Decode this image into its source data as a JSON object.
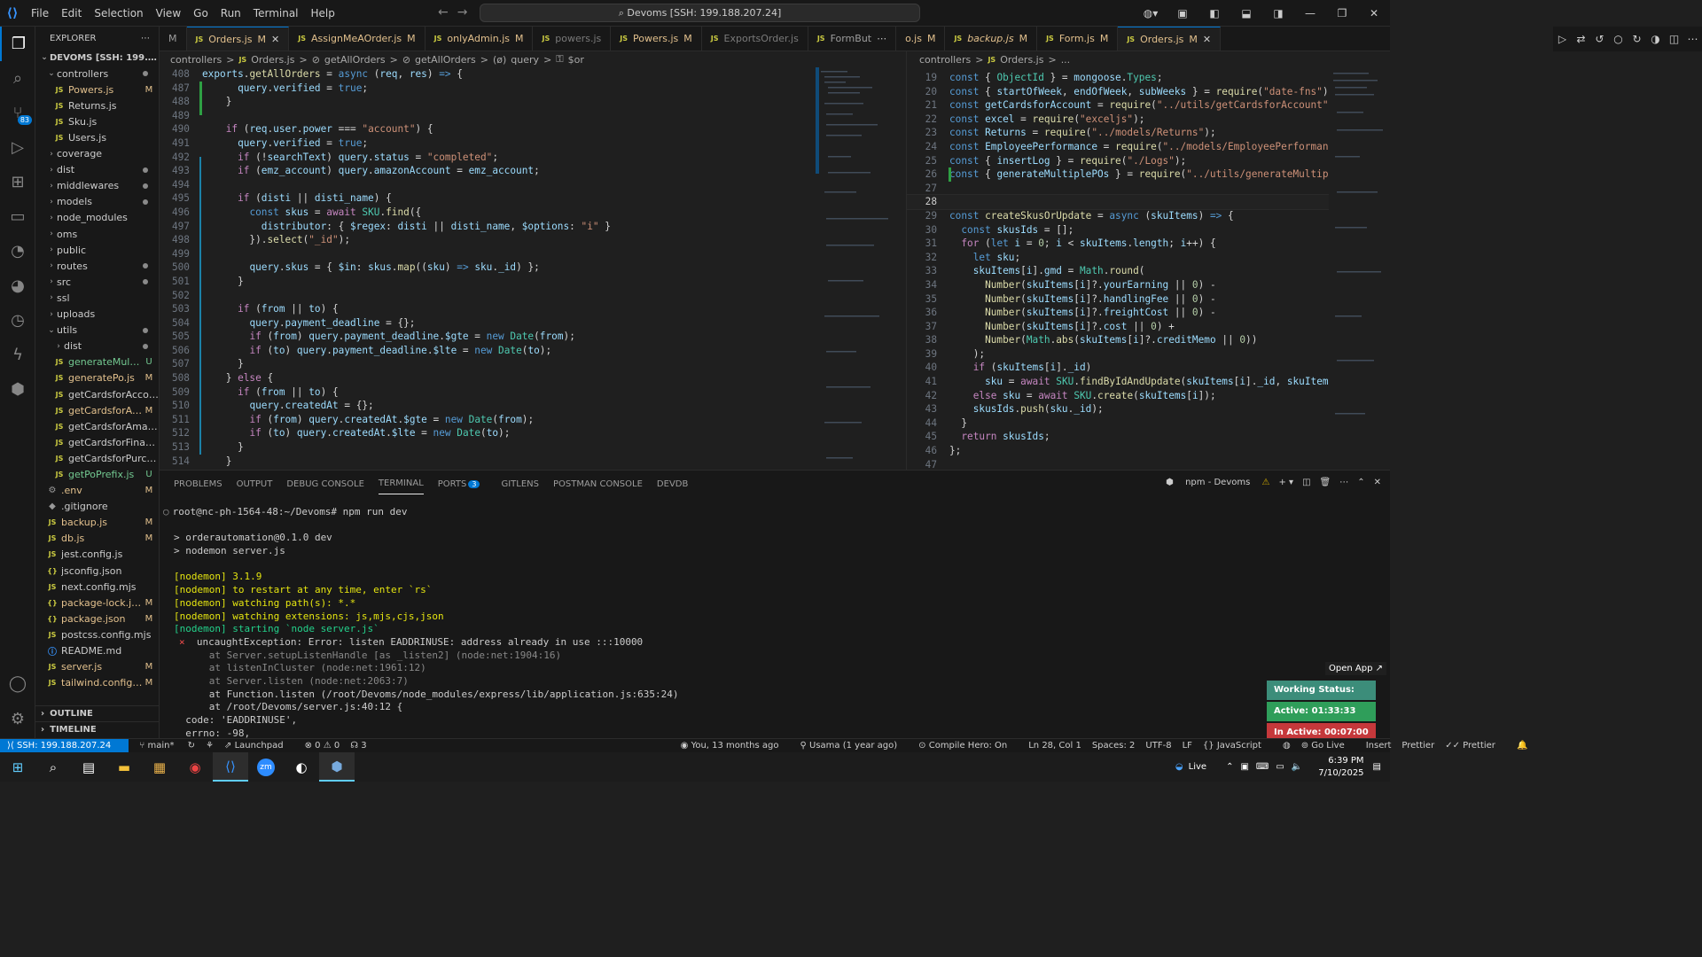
{
  "menu": [
    "File",
    "Edit",
    "Selection",
    "View",
    "Go",
    "Run",
    "Terminal",
    "Help"
  ],
  "title": "Devoms [SSH: 199.188.207.24]",
  "explorer": {
    "title": "EXPLORER",
    "root": "DEVOMS [SSH: 199.188.20...",
    "outline": "OUTLINE",
    "timeline": "TIMELINE"
  },
  "tree": [
    {
      "l": "controllers",
      "t": "folder",
      "o": true,
      "d": 1,
      "s": "dot"
    },
    {
      "l": "Powers.js",
      "t": "js",
      "d": 2,
      "s": "M"
    },
    {
      "l": "Returns.js",
      "t": "js",
      "d": 2,
      "s": ""
    },
    {
      "l": "Sku.js",
      "t": "js",
      "d": 2,
      "s": ""
    },
    {
      "l": "Users.js",
      "t": "js",
      "d": 2,
      "s": ""
    },
    {
      "l": "coverage",
      "t": "folder",
      "d": 1,
      "s": ""
    },
    {
      "l": "dist",
      "t": "folder",
      "d": 1,
      "s": "dot"
    },
    {
      "l": "middlewares",
      "t": "folder",
      "d": 1,
      "s": "dot"
    },
    {
      "l": "models",
      "t": "folder",
      "d": 1,
      "s": "dot"
    },
    {
      "l": "node_modules",
      "t": "folder",
      "d": 1,
      "s": ""
    },
    {
      "l": "oms",
      "t": "folder",
      "d": 1,
      "s": ""
    },
    {
      "l": "public",
      "t": "folder",
      "d": 1,
      "s": ""
    },
    {
      "l": "routes",
      "t": "folder",
      "d": 1,
      "s": "dot"
    },
    {
      "l": "src",
      "t": "folder",
      "d": 1,
      "s": "dot"
    },
    {
      "l": "ssl",
      "t": "folder",
      "d": 1,
      "s": ""
    },
    {
      "l": "uploads",
      "t": "folder",
      "d": 1,
      "s": ""
    },
    {
      "l": "utils",
      "t": "folder",
      "o": true,
      "d": 1,
      "s": "dot"
    },
    {
      "l": "dist",
      "t": "folder",
      "d": 2,
      "s": "dot"
    },
    {
      "l": "generateMulti...",
      "t": "js",
      "d": 2,
      "s": "U"
    },
    {
      "l": "generatePo.js",
      "t": "js",
      "d": 2,
      "s": "M"
    },
    {
      "l": "getCardsforAccount.js",
      "t": "js",
      "d": 2,
      "s": ""
    },
    {
      "l": "getCardsforAd...",
      "t": "js",
      "d": 2,
      "s": "M"
    },
    {
      "l": "getCardsforAmazon.js",
      "t": "js",
      "d": 2,
      "s": ""
    },
    {
      "l": "getCardsforFinance.js",
      "t": "js",
      "d": 2,
      "s": ""
    },
    {
      "l": "getCardsforPurchasi...",
      "t": "js",
      "d": 2,
      "s": ""
    },
    {
      "l": "getPoPrefix.js",
      "t": "js",
      "d": 2,
      "s": "U"
    },
    {
      "l": ".env",
      "t": "gear",
      "d": 1,
      "s": "M"
    },
    {
      "l": ".gitignore",
      "t": "git",
      "d": 1,
      "s": ""
    },
    {
      "l": "backup.js",
      "t": "js",
      "d": 1,
      "s": "M"
    },
    {
      "l": "db.js",
      "t": "js",
      "d": 1,
      "s": "M"
    },
    {
      "l": "jest.config.js",
      "t": "js",
      "d": 1,
      "s": ""
    },
    {
      "l": "jsconfig.json",
      "t": "json",
      "d": 1,
      "s": ""
    },
    {
      "l": "next.config.mjs",
      "t": "js",
      "d": 1,
      "s": ""
    },
    {
      "l": "package-lock.json",
      "t": "json",
      "d": 1,
      "s": "M"
    },
    {
      "l": "package.json",
      "t": "json",
      "d": 1,
      "s": "M"
    },
    {
      "l": "postcss.config.mjs",
      "t": "js",
      "d": 1,
      "s": ""
    },
    {
      "l": "README.md",
      "t": "info",
      "d": 1,
      "s": ""
    },
    {
      "l": "server.js",
      "t": "js",
      "d": 1,
      "s": "M"
    },
    {
      "l": "tailwind.config.js",
      "t": "js",
      "d": 1,
      "s": "M"
    }
  ],
  "tabs": [
    {
      "l": "M",
      "pre": true
    },
    {
      "l": "Orders.js",
      "m": "M",
      "active": true,
      "x": true
    },
    {
      "l": "AssignMeAOrder.js",
      "m": "M"
    },
    {
      "l": "onlyAdmin.js",
      "m": "M"
    },
    {
      "l": "powers.js",
      "dim": true
    },
    {
      "l": "Powers.js",
      "m": "M"
    },
    {
      "l": "ExportsOrder.js",
      "dim": true
    },
    {
      "l": "FormBut"
    },
    {
      "l": "o.js",
      "m": "M",
      "nojs": true
    },
    {
      "l": "backup.js",
      "m": "M",
      "it": true
    },
    {
      "l": "Form.js",
      "m": "M"
    },
    {
      "l": "Orders.js",
      "m": "M",
      "active": true,
      "x": true
    }
  ],
  "crumbs_left": [
    "controllers",
    ">",
    "JS",
    "Orders.js",
    ">",
    "⊘",
    "getAllOrders",
    ">",
    "⊘",
    "getAllOrders",
    ">",
    "(ø)",
    "query",
    ">",
    "⚿",
    "$or"
  ],
  "crumbs_right": [
    "controllers",
    ">",
    "JS",
    "Orders.js",
    ">",
    "..."
  ],
  "editor_left": [
    {
      "n": "408",
      "h": "<span class=\"var\">exports</span>.<span class=\"fn\">getAllOrders</span> = <span class=\"kw\">async</span> (<span class=\"var\">req</span>, <span class=\"var\">res</span>) <span class=\"kw\">=&gt;</span> {"
    },
    {
      "n": "487",
      "h": "      <span class=\"var\">query</span>.<span class=\"var\">verified</span> = <span class=\"kw\">true</span>;"
    },
    {
      "n": "488",
      "h": "    }"
    },
    {
      "n": "489",
      "h": ""
    },
    {
      "n": "490",
      "h": "    <span class=\"kc\">if</span> (<span class=\"var\">req</span>.<span class=\"var\">user</span>.<span class=\"var\">power</span> === <span class=\"str\">\"account\"</span>) {"
    },
    {
      "n": "491",
      "h": "      <span class=\"var\">query</span>.<span class=\"var\">verified</span> = <span class=\"kw\">true</span>;"
    },
    {
      "n": "492",
      "h": "      <span class=\"kc\">if</span> (!<span class=\"var\">searchText</span>) <span class=\"var\">query</span>.<span class=\"var\">status</span> = <span class=\"str\">\"completed\"</span>;"
    },
    {
      "n": "493",
      "h": "      <span class=\"kc\">if</span> (<span class=\"var\">emz_account</span>) <span class=\"var\">query</span>.<span class=\"var\">amazonAccount</span> = <span class=\"var\">emz_account</span>;"
    },
    {
      "n": "494",
      "h": ""
    },
    {
      "n": "495",
      "h": "      <span class=\"kc\">if</span> (<span class=\"var\">disti</span> || <span class=\"var\">disti_name</span>) {"
    },
    {
      "n": "496",
      "h": "        <span class=\"kw\">const</span> <span class=\"var\">skus</span> = <span class=\"kc\">await</span> <span class=\"cls\">SKU</span>.<span class=\"fn\">find</span>({"
    },
    {
      "n": "497",
      "h": "          <span class=\"var\">distributor</span>: { <span class=\"var\">$regex</span>: <span class=\"var\">disti</span> || <span class=\"var\">disti_name</span>, <span class=\"var\">$options</span>: <span class=\"str\">\"i\"</span> }"
    },
    {
      "n": "498",
      "h": "        }).<span class=\"fn\">select</span>(<span class=\"str\">\"_id\"</span>);"
    },
    {
      "n": "499",
      "h": ""
    },
    {
      "n": "500",
      "h": "        <span class=\"var\">query</span>.<span class=\"var\">skus</span> = { <span class=\"var\">$in</span>: <span class=\"var\">skus</span>.<span class=\"fn\">map</span>((<span class=\"var\">sku</span>) <span class=\"kw\">=&gt;</span> <span class=\"var\">sku</span>.<span class=\"var\">_id</span>) };"
    },
    {
      "n": "501",
      "h": "      }"
    },
    {
      "n": "502",
      "h": ""
    },
    {
      "n": "503",
      "h": "      <span class=\"kc\">if</span> (<span class=\"var\">from</span> || <span class=\"var\">to</span>) {"
    },
    {
      "n": "504",
      "h": "        <span class=\"var\">query</span>.<span class=\"var\">payment_deadline</span> = {};"
    },
    {
      "n": "505",
      "h": "        <span class=\"kc\">if</span> (<span class=\"var\">from</span>) <span class=\"var\">query</span>.<span class=\"var\">payment_deadline</span>.<span class=\"var\">$gte</span> = <span class=\"kw\">new</span> <span class=\"cls\">Date</span>(<span class=\"var\">from</span>);"
    },
    {
      "n": "506",
      "h": "        <span class=\"kc\">if</span> (<span class=\"var\">to</span>) <span class=\"var\">query</span>.<span class=\"var\">payment_deadline</span>.<span class=\"var\">$lte</span> = <span class=\"kw\">new</span> <span class=\"cls\">Date</span>(<span class=\"var\">to</span>);"
    },
    {
      "n": "507",
      "h": "      }"
    },
    {
      "n": "508",
      "h": "    } <span class=\"kc\">else</span> {"
    },
    {
      "n": "509",
      "h": "      <span class=\"kc\">if</span> (<span class=\"var\">from</span> || <span class=\"var\">to</span>) {"
    },
    {
      "n": "510",
      "h": "        <span class=\"var\">query</span>.<span class=\"var\">createdAt</span> = {};"
    },
    {
      "n": "511",
      "h": "        <span class=\"kc\">if</span> (<span class=\"var\">from</span>) <span class=\"var\">query</span>.<span class=\"var\">createdAt</span>.<span class=\"var\">$gte</span> = <span class=\"kw\">new</span> <span class=\"cls\">Date</span>(<span class=\"var\">from</span>);"
    },
    {
      "n": "512",
      "h": "        <span class=\"kc\">if</span> (<span class=\"var\">to</span>) <span class=\"var\">query</span>.<span class=\"var\">createdAt</span>.<span class=\"var\">$lte</span> = <span class=\"kw\">new</span> <span class=\"cls\">Date</span>(<span class=\"var\">to</span>);"
    },
    {
      "n": "513",
      "h": "      }"
    },
    {
      "n": "514",
      "h": "    }"
    }
  ],
  "editor_right": [
    {
      "n": "19",
      "h": "<span class=\"kw\">const</span> { <span class=\"cls\">ObjectId</span> } = <span class=\"var\">mongoose</span>.<span class=\"cls\">Types</span>;"
    },
    {
      "n": "20",
      "h": "<span class=\"kw\">const</span> { <span class=\"var\">startOfWeek</span>, <span class=\"var\">endOfWeek</span>, <span class=\"var\">subWeeks</span> } = <span class=\"fn\">require</span>(<span class=\"str\">\"date-fns\"</span>);"
    },
    {
      "n": "21",
      "h": "<span class=\"kw\">const</span> <span class=\"var\">getCardsforAccount</span> = <span class=\"fn\">require</span>(<span class=\"str\">\"../utils/getCardsforAccount\"</span>);"
    },
    {
      "n": "22",
      "h": "<span class=\"kw\">const</span> <span class=\"var\">excel</span> = <span class=\"fn\">require</span>(<span class=\"str\">\"exceljs\"</span>);"
    },
    {
      "n": "23",
      "h": "<span class=\"kw\">const</span> <span class=\"var\">Returns</span> = <span class=\"fn\">require</span>(<span class=\"str\">\"../models/Returns\"</span>);"
    },
    {
      "n": "24",
      "h": "<span class=\"kw\">const</span> <span class=\"var\">EmployeePerformance</span> = <span class=\"fn\">require</span>(<span class=\"str\">\"../models/EmployeePerformanc</span>"
    },
    {
      "n": "25",
      "h": "<span class=\"kw\">const</span> { <span class=\"var\">insertLog</span> } = <span class=\"fn\">require</span>(<span class=\"str\">\"./Logs\"</span>);"
    },
    {
      "n": "26",
      "h": "<span class=\"kw\">const</span> { <span class=\"var\">generateMultiplePOs</span> } = <span class=\"fn\">require</span>(<span class=\"str\">\"../utils/generateMultipl</span>"
    },
    {
      "n": "27",
      "h": ""
    },
    {
      "n": "28",
      "h": "",
      "cur": true
    },
    {
      "n": "29",
      "h": "<span class=\"kw\">const</span> <span class=\"fn\">createSkusOrUpdate</span> = <span class=\"kw\">async</span> (<span class=\"var\">skuItems</span>) <span class=\"kw\">=&gt;</span> {"
    },
    {
      "n": "30",
      "h": "  <span class=\"kw\">const</span> <span class=\"var\">skusIds</span> = [];"
    },
    {
      "n": "31",
      "h": "  <span class=\"kc\">for</span> (<span class=\"kw\">let</span> <span class=\"var\">i</span> = <span class=\"num\">0</span>; <span class=\"var\">i</span> &lt; <span class=\"var\">skuItems</span>.<span class=\"var\">length</span>; <span class=\"var\">i</span>++) {"
    },
    {
      "n": "32",
      "h": "    <span class=\"kw\">let</span> <span class=\"var\">sku</span>;"
    },
    {
      "n": "33",
      "h": "    <span class=\"var\">skuItems</span>[<span class=\"var\">i</span>].<span class=\"var\">gmd</span> = <span class=\"cls\">Math</span>.<span class=\"fn\">round</span>("
    },
    {
      "n": "34",
      "h": "      <span class=\"fn\">Number</span>(<span class=\"var\">skuItems</span>[<span class=\"var\">i</span>]?.<span class=\"var\">yourEarning</span> || <span class=\"num\">0</span>) -"
    },
    {
      "n": "35",
      "h": "      <span class=\"fn\">Number</span>(<span class=\"var\">skuItems</span>[<span class=\"var\">i</span>]?.<span class=\"var\">handlingFee</span> || <span class=\"num\">0</span>) -"
    },
    {
      "n": "36",
      "h": "      <span class=\"fn\">Number</span>(<span class=\"var\">skuItems</span>[<span class=\"var\">i</span>]?.<span class=\"var\">freightCost</span> || <span class=\"num\">0</span>) -"
    },
    {
      "n": "37",
      "h": "      <span class=\"fn\">Number</span>(<span class=\"var\">skuItems</span>[<span class=\"var\">i</span>]?.<span class=\"var\">cost</span> || <span class=\"num\">0</span>) +"
    },
    {
      "n": "38",
      "h": "      <span class=\"fn\">Number</span>(<span class=\"cls\">Math</span>.<span class=\"fn\">abs</span>(<span class=\"var\">skuItems</span>[<span class=\"var\">i</span>]?.<span class=\"var\">creditMemo</span> || <span class=\"num\">0</span>))"
    },
    {
      "n": "39",
      "h": "    );"
    },
    {
      "n": "40",
      "h": "    <span class=\"kc\">if</span> (<span class=\"var\">skuItems</span>[<span class=\"var\">i</span>].<span class=\"var\">_id</span>)"
    },
    {
      "n": "41",
      "h": "      <span class=\"var\">sku</span> = <span class=\"kc\">await</span> <span class=\"cls\">SKU</span>.<span class=\"fn\">findByIdAndUpdate</span>(<span class=\"var\">skuItems</span>[<span class=\"var\">i</span>].<span class=\"var\">_id</span>, <span class=\"var\">skuItems</span>"
    },
    {
      "n": "42",
      "h": "    <span class=\"kc\">else</span> <span class=\"var\">sku</span> = <span class=\"kc\">await</span> <span class=\"cls\">SKU</span>.<span class=\"fn\">create</span>(<span class=\"var\">skuItems</span>[<span class=\"var\">i</span>]);"
    },
    {
      "n": "43",
      "h": "    <span class=\"var\">skusIds</span>.<span class=\"fn\">push</span>(<span class=\"var\">sku</span>.<span class=\"var\">_id</span>);"
    },
    {
      "n": "44",
      "h": "  }"
    },
    {
      "n": "45",
      "h": "  <span class=\"kc\">return</span> <span class=\"var\">skusIds</span>;"
    },
    {
      "n": "46",
      "h": "};"
    },
    {
      "n": "47",
      "h": ""
    }
  ],
  "panel": {
    "tabs": [
      "PROBLEMS",
      "OUTPUT",
      "DEBUG CONSOLE",
      "TERMINAL",
      "PORTS",
      "GITLENS",
      "POSTMAN CONSOLE",
      "DEVDB"
    ],
    "ports_count": "3",
    "term_name": "npm - Devoms"
  },
  "terminal": [
    {
      "c": "",
      "t": "root@nc-ph-1564-48:~/Devoms# npm run dev"
    },
    {
      "c": "",
      "t": ""
    },
    {
      "c": "",
      "t": "> orderautomation@0.1.0 dev"
    },
    {
      "c": "",
      "t": "> nodemon server.js"
    },
    {
      "c": "",
      "t": ""
    },
    {
      "c": "y",
      "t": "[nodemon] 3.1.9"
    },
    {
      "c": "y",
      "t": "[nodemon] to restart at any time, enter `rs`"
    },
    {
      "c": "y",
      "t": "[nodemon] watching path(s): *.*"
    },
    {
      "c": "y",
      "t": "[nodemon] watching extensions: js,mjs,cjs,json"
    },
    {
      "c": "gr",
      "t": "[nodemon] starting `node server.js`"
    },
    {
      "c": "err",
      "t": "  uncaughtException: Error: listen EADDRINUSE: address already in use :::10000"
    },
    {
      "c": "g",
      "t": "      at Server.setupListenHandle [as _listen2] (node:net:1904:16)"
    },
    {
      "c": "g",
      "t": "      at listenInCluster (node:net:1961:12)"
    },
    {
      "c": "g",
      "t": "      at Server.listen (node:net:2063:7)"
    },
    {
      "c": "",
      "t": "      at Function.listen (/root/Devoms/node_modules/express/lib/application.js:635:24)"
    },
    {
      "c": "",
      "t": "      at /root/Devoms/server.js:40:12 {"
    },
    {
      "c": "",
      "t": "  code: 'EADDRINUSE',"
    },
    {
      "c": "",
      "t": "  errno: -98,"
    }
  ],
  "widgets": {
    "open_app": "Open App ↗",
    "working": "Working Status: Active",
    "active": "Active: 01:33:33",
    "inactive": "In Active: 00:07:00"
  },
  "status": {
    "remote": "SSH: 199.188.207.24",
    "branch": "main*",
    "launchpad": "Launchpad",
    "problems": "⊗ 0 ⚠ 0",
    "ports": "3",
    "blame": "You, 13 months ago",
    "author": "Usama (1 year ago)",
    "compile": "Compile Hero: On",
    "pos": "Ln 28, Col 1",
    "spaces": "Spaces: 2",
    "enc": "UTF-8",
    "eol": "LF",
    "lang": "JavaScript",
    "golive": "Go Live",
    "insert": "Insert",
    "prettier1": "Prettier",
    "prettier2": "Prettier"
  },
  "tray": {
    "live": "Live",
    "time": "6:39 PM",
    "date": "7/10/2025"
  },
  "colors": {
    "accent": "#0078d4",
    "active_green": "#2ea043",
    "inactive_red": "#c5383b",
    "widget_green": "#2f9e5a",
    "widget_teal": "#3c8d7a"
  }
}
